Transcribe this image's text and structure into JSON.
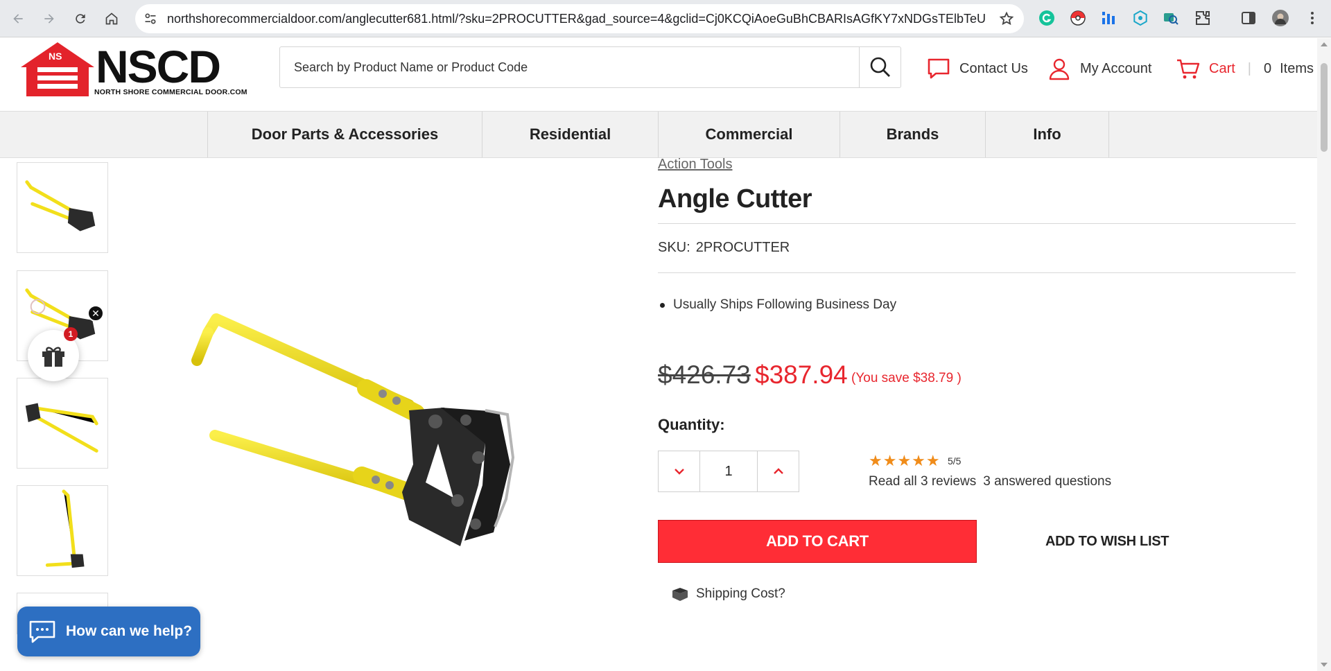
{
  "browser": {
    "url": "northshorecommercialdoor.com/anglecutter681.html/?sku=2PROCUTTER&gad_source=4&gclid=Cj0KCQiAoeGuBhCBARIsAGfKY7xNDGsTElbTeUb0l0f59..."
  },
  "header": {
    "logo_initials": "NS",
    "logo_text": "NSCD",
    "logo_subtitle": "NORTH SHORE COMMERCIAL DOOR.COM",
    "search_placeholder": "Search by Product Name or Product Code",
    "contact_label": "Contact Us",
    "account_label": "My Account",
    "cart_label": "Cart",
    "cart_count": "0",
    "cart_items_label": "Items"
  },
  "nav": {
    "items": [
      {
        "label": "Door Parts & Accessories"
      },
      {
        "label": "Residential"
      },
      {
        "label": "Commercial"
      },
      {
        "label": "Brands"
      },
      {
        "label": "Info"
      }
    ]
  },
  "product": {
    "brand": "Action Tools",
    "title": "Angle Cutter",
    "sku_label": "SKU:",
    "sku": "2PROCUTTER",
    "shipping_note": "Usually Ships Following Business Day",
    "old_price": "$426.73",
    "price": "$387.94",
    "savings": "(You save $38.79 )",
    "quantity_label": "Quantity:",
    "quantity": "1",
    "rating_stars": "★★★★★",
    "rating_score": "5/5",
    "reviews_link": "Read all 3 reviews",
    "questions_link": "3 answered questions",
    "add_to_cart": "ADD TO CART",
    "add_to_wishlist": "ADD TO WISH LIST",
    "shipping_cost": "Shipping Cost?"
  },
  "widgets": {
    "gift_badge": "1",
    "chat_label": "How can we help?"
  },
  "colors": {
    "accent_red": "#e8262e",
    "button_red": "#ff2d36",
    "chat_blue": "#2d6fc2",
    "star_orange": "#f08c1a",
    "tool_yellow": "#f2df1b"
  }
}
